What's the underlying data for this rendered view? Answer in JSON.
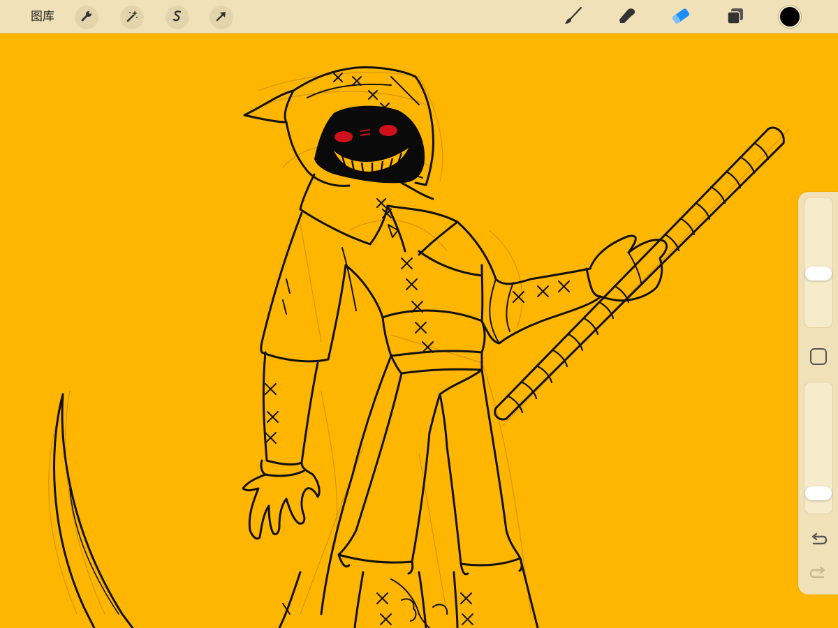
{
  "toolbar": {
    "gallery_label": "图库",
    "actions_icon": "wrench-icon",
    "adjustments_icon": "magic-wand-icon",
    "selection_icon": "selection-s-icon",
    "transform_icon": "arrow-cursor-icon",
    "brush_icon": "brush-icon",
    "smudge_icon": "smudge-icon",
    "eraser_icon": "eraser-icon",
    "layers_icon": "layers-icon",
    "current_color": "#000000",
    "active_tool": "eraser"
  },
  "canvas": {
    "background_color": "#ffb600",
    "subject": "reaper-character-sketch"
  },
  "sidebar": {
    "brush_size": 0.4,
    "brush_opacity": 0.1,
    "undo_icon": "undo-icon",
    "redo_icon": "redo-icon"
  },
  "colors": {
    "toolbar_bg": "#f1e1b8",
    "active_tool": "#1e8fff",
    "ink": "#111111",
    "sketch": "#b47a1f",
    "eyes": "#d0101c"
  }
}
